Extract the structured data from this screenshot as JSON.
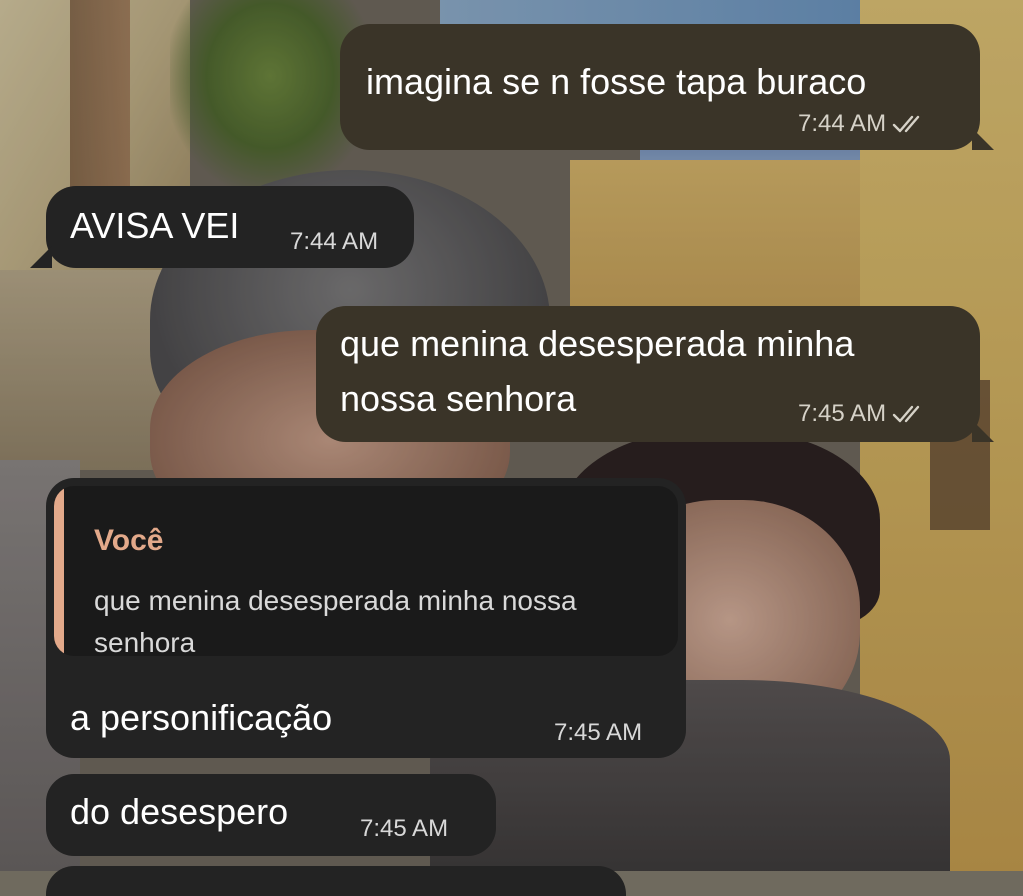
{
  "messages": [
    {
      "direction": "outgoing",
      "text": "imagina se n fosse tapa buraco",
      "time": "7:44 AM",
      "status": "read-double-check"
    },
    {
      "direction": "incoming",
      "text": "AVISA VEI",
      "time": "7:44 AM"
    },
    {
      "direction": "outgoing",
      "lines": [
        "que menina desesperada minha",
        "nossa senhora"
      ],
      "time": "7:45 AM",
      "status": "read-double-check"
    },
    {
      "direction": "incoming",
      "reply_to": {
        "author": "Você",
        "text": "que menina desesperada minha nossa senhora"
      },
      "text": "a personificação",
      "time": "7:45 AM"
    },
    {
      "direction": "incoming",
      "text": "do desespero",
      "time": "7:45 AM"
    }
  ],
  "colors": {
    "outgoing_bubble": "#3a3428",
    "incoming_bubble": "#232323",
    "quote_accent": "#e3a98a"
  }
}
